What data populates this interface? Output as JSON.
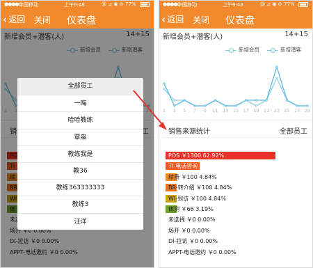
{
  "status_bar": {
    "carrier": "中国移动",
    "time": "上午9:48",
    "icons": "@ ⊿ ◉ ⊘",
    "battery": "77%"
  },
  "nav": {
    "back_label": "返回",
    "close_label": "关闭",
    "title": "仪表盘"
  },
  "stats": {
    "label": "新增会员+潜客(人)",
    "count": "14+15"
  },
  "legend": {
    "items": [
      "新增会员",
      "新增潜客"
    ]
  },
  "chart_data": {
    "type": "line",
    "x": [
      1,
      3,
      5,
      7,
      9,
      11,
      13,
      15,
      17,
      19,
      21,
      23,
      25,
      27,
      29
    ],
    "xlabels_shown": [
      "1",
      "3",
      "5",
      "7",
      "9",
      "11",
      "13",
      "15",
      "17",
      "19",
      "21",
      "23",
      "25",
      "27",
      "29"
    ],
    "series": [
      {
        "name": "新增会员",
        "values": [
          3,
          1,
          1,
          0,
          0,
          1,
          0,
          0,
          1,
          0,
          1,
          5,
          1,
          0,
          0
        ]
      },
      {
        "name": "新增潜客",
        "values": [
          4,
          0,
          1,
          0,
          0,
          1,
          0,
          0,
          1,
          1,
          1,
          7,
          1,
          0,
          0
        ]
      }
    ],
    "ylim": [
      0,
      8
    ],
    "grid": false,
    "colors": [
      "#8ccfe8",
      "#5bb8de"
    ]
  },
  "source_section": {
    "title": "销售来源统计",
    "filter": "全部员工",
    "left_title_cut": "销售",
    "left_filter_cut": "员工"
  },
  "source_rows": [
    {
      "text": "POS ￥1300 62.92%",
      "share": 0.6292,
      "color": "#e8322a"
    },
    {
      "text": "TI-电话咨询 ￥400 19.36%",
      "share": 0.1936,
      "color": "#ef5a26"
    },
    {
      "text": "续费 ￥100 4.84%",
      "share": 0.0484,
      "color": "#f08a22"
    },
    {
      "text": "BR-转介绍 ￥100 4.84%",
      "share": 0.0484,
      "color": "#e9741e"
    },
    {
      "text": "WI-到访 ￥100 4.84%",
      "share": 0.0484,
      "color": "#c9a61c"
    },
    {
      "text": "体测 ￥66 3.19%",
      "share": 0.0319,
      "color": "#6fa22b"
    },
    {
      "text": "未选择 ￥0 0.00%",
      "share": 0,
      "color": "#cccccc"
    },
    {
      "text": "场开 ￥0 0.00%",
      "share": 0,
      "color": "#cccccc"
    },
    {
      "text": "DI-拉访 ￥0 0.00%",
      "share": 0,
      "color": "#cccccc"
    },
    {
      "text": "APPT-电话邀约 ￥0 0.00%",
      "share": 0,
      "color": "#cccccc"
    }
  ],
  "left_rows_visible": [
    {
      "text": "PO",
      "color": "#e8322a"
    },
    {
      "text": "TI",
      "color": "#ef5a26"
    },
    {
      "text": "续",
      "color": "#f08a22"
    },
    {
      "text": "BR",
      "color": "#e9741e"
    },
    {
      "text": "WI",
      "color": "#c9a61c"
    },
    {
      "text": "体",
      "color": "#6fa22b"
    },
    {
      "text": "未选择 ￥0 0.00%",
      "color": "#cccccc"
    },
    {
      "text": "场开 ￥0 0.00%",
      "color": "#cccccc"
    },
    {
      "text": "DI-拉访 ￥0 0.00%",
      "color": "#cccccc"
    },
    {
      "text": "APPT-电话邀约 ￥0 0.00%",
      "color": "#cccccc"
    }
  ],
  "dropdown": {
    "options": [
      "全部员工",
      "一晦",
      "哈哈教练",
      "覃枭",
      "教练我是",
      "教36",
      "教练363333333",
      "教练3",
      "汪洋"
    ]
  },
  "colors": {
    "brand": "#f28a2d",
    "pointer": "#e8322a"
  }
}
